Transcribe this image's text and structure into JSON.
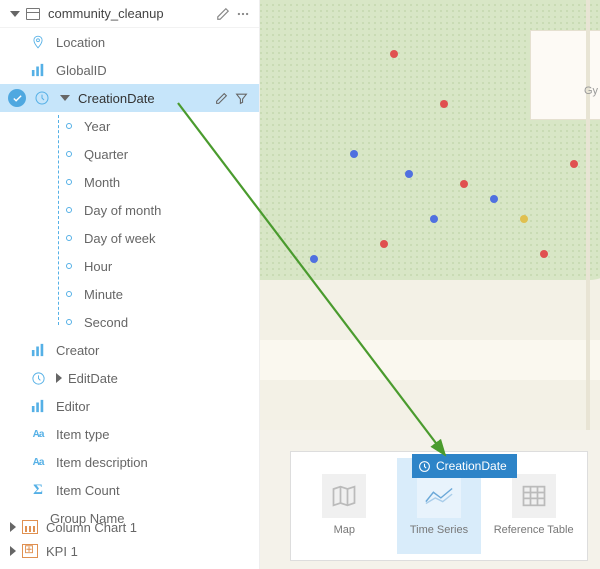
{
  "layer": {
    "name": "community_cleanup"
  },
  "fields": {
    "location": "Location",
    "globalid": "GlobalID",
    "creationdate": "CreationDate",
    "creator": "Creator",
    "editdate": "EditDate",
    "editor": "Editor",
    "itemtype": "Item type",
    "itemdesc": "Item description",
    "itemcount": "Item Count",
    "groupname": "Group Name"
  },
  "date_parts": {
    "year": "Year",
    "quarter": "Quarter",
    "month": "Month",
    "dom": "Day of month",
    "dow": "Day of week",
    "hour": "Hour",
    "minute": "Minute",
    "second": "Second"
  },
  "charts": {
    "column1": "Column Chart 1",
    "kpi1": "KPI 1"
  },
  "drop": {
    "chip": "CreationDate",
    "map": "Map",
    "timeseries": "Time Series",
    "reftable": "Reference Table"
  },
  "map": {
    "label_gy": "Gy"
  }
}
